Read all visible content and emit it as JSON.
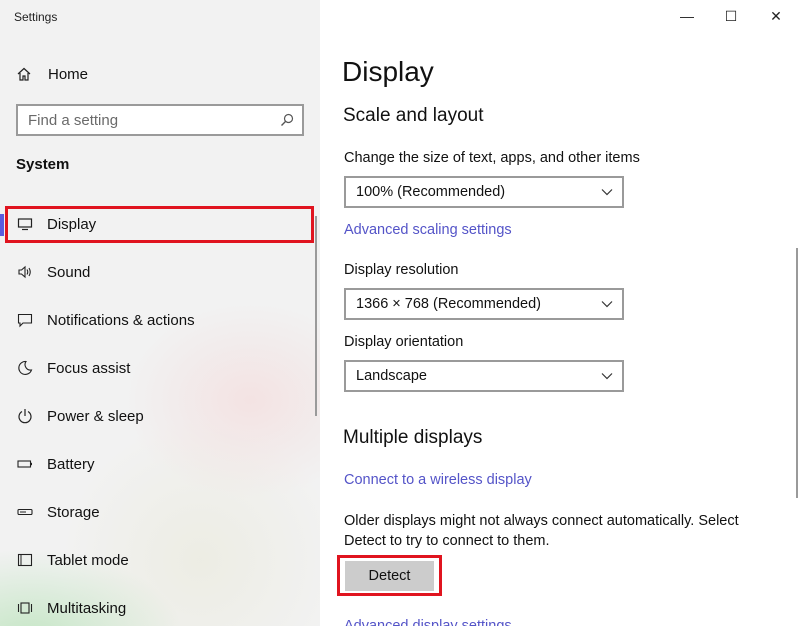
{
  "window": {
    "title": "Settings",
    "minimize": "—",
    "maximize": "☐",
    "close": "✕"
  },
  "sidebar": {
    "home_label": "Home",
    "search_placeholder": "Find a setting",
    "section_title": "System",
    "items": [
      {
        "label": "Display",
        "icon": "monitor-icon",
        "selected": true
      },
      {
        "label": "Sound",
        "icon": "speaker-icon"
      },
      {
        "label": "Notifications & actions",
        "icon": "message-icon"
      },
      {
        "label": "Focus assist",
        "icon": "moon-icon"
      },
      {
        "label": "Power & sleep",
        "icon": "power-icon"
      },
      {
        "label": "Battery",
        "icon": "battery-icon"
      },
      {
        "label": "Storage",
        "icon": "storage-icon"
      },
      {
        "label": "Tablet mode",
        "icon": "tablet-icon"
      },
      {
        "label": "Multitasking",
        "icon": "multitask-icon"
      }
    ]
  },
  "main": {
    "page_title": "Display",
    "scale_layout": {
      "heading": "Scale and layout",
      "scale_label": "Change the size of text, apps, and other items",
      "scale_value": "100% (Recommended)",
      "advanced_link": "Advanced scaling settings",
      "resolution_label": "Display resolution",
      "resolution_value": "1366 × 768 (Recommended)",
      "orientation_label": "Display orientation",
      "orientation_value": "Landscape"
    },
    "multiple_displays": {
      "heading": "Multiple displays",
      "wireless_link": "Connect to a wireless display",
      "description": "Older displays might not always connect automatically. Select Detect to try to connect to them.",
      "detect_label": "Detect",
      "cutoff_link": "Advanced display settings"
    }
  },
  "colors": {
    "accent": "#5c5ce0",
    "link": "#5454c8",
    "highlight_border": "#e0141f",
    "button_bg": "#cccccc"
  }
}
